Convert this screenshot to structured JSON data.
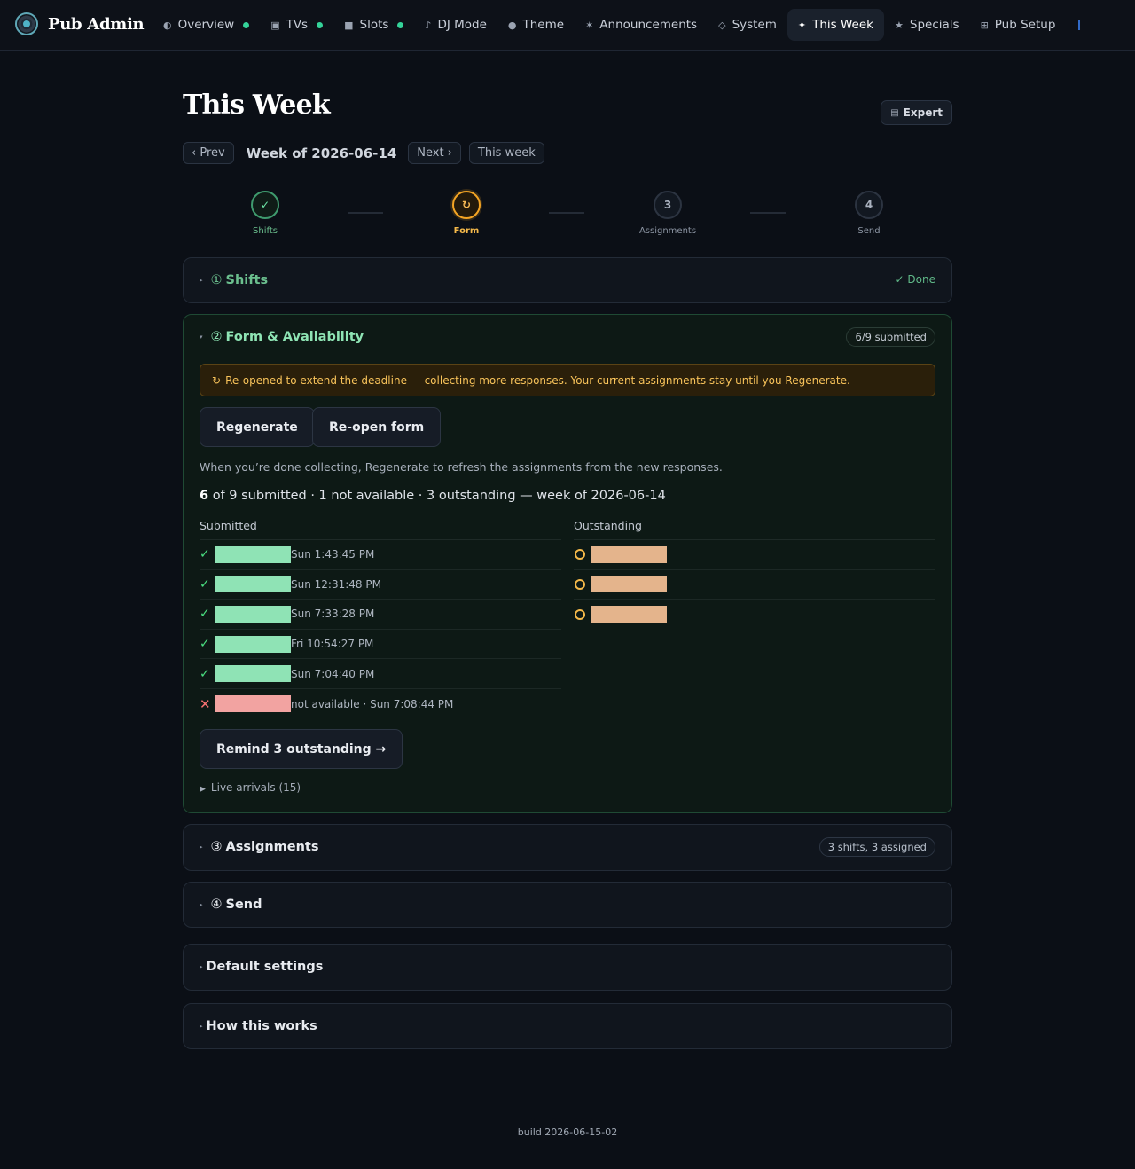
{
  "brand": {
    "name": "Pub Admin"
  },
  "nav": [
    {
      "label": "Overview",
      "icon": "◐",
      "dot": true
    },
    {
      "label": "TVs",
      "icon": "▣",
      "dot": true
    },
    {
      "label": "Slots",
      "icon": "■",
      "dot": true
    },
    {
      "label": "DJ Mode",
      "icon": "♪",
      "dot": false
    },
    {
      "label": "Theme",
      "icon": "●",
      "dot": false
    },
    {
      "label": "Announcements",
      "icon": "✶",
      "dot": false
    },
    {
      "label": "System",
      "icon": "◇",
      "dot": false
    },
    {
      "label": "This Week",
      "icon": "✦",
      "dot": false,
      "active": true
    },
    {
      "label": "Specials",
      "icon": "★",
      "dot": false
    },
    {
      "label": "Pub Setup",
      "icon": "⊞",
      "dot": false
    }
  ],
  "page": {
    "title": "This Week",
    "expert_label": "Expert",
    "prev_label": "‹ Prev",
    "week_label": "Week of 2026-06-14",
    "next_label": "Next ›",
    "this_week_label": "This week"
  },
  "stepper": [
    {
      "label": "Shifts",
      "mark": "✓",
      "state": "done"
    },
    {
      "label": "Form",
      "mark": "↻",
      "state": "active"
    },
    {
      "label": "Assignments",
      "mark": "3",
      "state": "pending"
    },
    {
      "label": "Send",
      "mark": "4",
      "state": "pending"
    }
  ],
  "shifts": {
    "num": "①",
    "title": "Shifts",
    "status": "✓ Done"
  },
  "form": {
    "num": "②",
    "title": "Form & Availability",
    "pill": "6/9 submitted",
    "alert": "Re-opened to extend the deadline — collecting more responses. Your current assignments stay until you Regenerate.",
    "regenerate_label": "Regenerate",
    "reopen_label": "Re-open form",
    "hint": "When you’re done collecting, Regenerate to refresh the assignments from the new responses.",
    "summary_count": "6",
    "summary_rest": " of 9 submitted · 1 not available · 3 outstanding — week of 2026-06-14",
    "submitted_header": "Submitted",
    "outstanding_header": "Outstanding",
    "submitted": [
      {
        "time": "Sun 1:43:45 PM",
        "ok": true
      },
      {
        "time": "Sun 12:31:48 PM",
        "ok": true
      },
      {
        "time": "Sun 7:33:28 PM",
        "ok": true
      },
      {
        "time": "Fri 10:54:27 PM",
        "ok": true
      },
      {
        "time": "Sun 7:04:40 PM",
        "ok": true
      },
      {
        "time": "not available · Sun 7:08:44 PM",
        "ok": false
      }
    ],
    "outstanding_count": 3,
    "remind_label": "Remind 3 outstanding →",
    "live_label": "Live arrivals (15)"
  },
  "assignments": {
    "num": "③",
    "title": "Assignments",
    "pill": "3 shifts, 3 assigned"
  },
  "send": {
    "num": "④",
    "title": "Send"
  },
  "defaults": {
    "title": "Default settings"
  },
  "how": {
    "title": "How this works"
  },
  "footer": {
    "build": "build 2026-06-15-02"
  },
  "colors": {
    "accent_green": "#34d399",
    "warning_amber": "#f5a524",
    "submitted_bar": "#8fe3b5",
    "unavailable_bar": "#f2a3a1",
    "outstanding_bar": "#e4b48c"
  }
}
